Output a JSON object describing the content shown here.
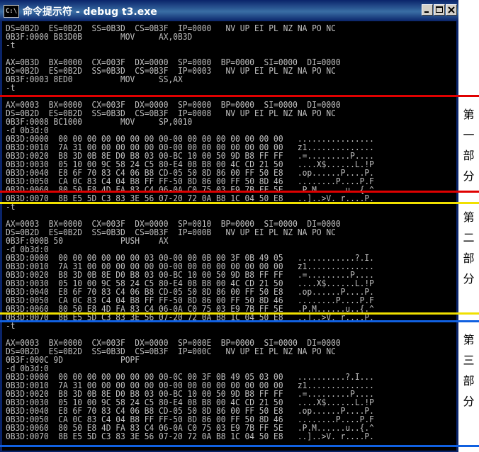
{
  "window": {
    "title": "命令提示符 - debug t3.exe",
    "icon_text": "C:\\",
    "buttons": [
      "minimize",
      "maximize",
      "close"
    ]
  },
  "colors": {
    "console_bg": "#000000",
    "console_text": "#c0c0c0",
    "titlebar": "#0a246a",
    "marker_red": "#e00000",
    "marker_yellow": "#f0e000",
    "marker_blue": "#1060e0"
  },
  "console": {
    "lines": [
      "DS=0B2D  ES=0B2D  SS=0B3D  CS=0B3F  IP=0000   NV UP EI PL NZ NA PO NC",
      "0B3F:0000 B83D0B        MOV     AX,0B3D",
      "-t",
      "",
      "AX=0B3D  BX=0000  CX=003F  DX=0000  SP=0000  BP=0000  SI=0000  DI=0000",
      "DS=0B2D  ES=0B2D  SS=0B3D  CS=0B3F  IP=0003   NV UP EI PL NZ NA PO NC",
      "0B3F:0003 8ED0          MOV     SS,AX",
      "-t",
      "",
      "AX=0003  BX=0000  CX=003F  DX=0000  SP=0000  BP=0000  SI=0000  DI=0000",
      "DS=0B2D  ES=0B2D  SS=0B3D  CS=0B3F  IP=0008   NV UP EI PL NZ NA PO NC",
      "0B3F:0008 BC1000        MOV     SP,0010",
      "-d 0b3d:0",
      "0B3D:0000  00 00 00 00 00 00 00 00-00 00 00 00 00 00 00 00   ................",
      "0B3D:0010  7A 31 00 00 00 00 00 00-00 00 00 00 00 00 00 00   z1..............",
      "0B3D:0020  B8 3D 0B 8E D0 B8 03 00-BC 10 00 50 9D B8 FF FF   .=.........P....",
      "0B3D:0030  05 10 00 9C 58 24 C5 80-E4 08 B8 00 4C CD 21 50   ....X$......L.!P",
      "0B3D:0040  E8 6F 70 83 C4 06 B8 CD-05 50 8D 86 00 FF 50 E8   .op......P....P.",
      "0B3D:0050  CA 0C 83 C4 04 B8 FF FF-50 8D 86 00 FF 50 8D 46   ........P....P.F",
      "0B3D:0060  80 50 E8 4D FA 83 C4 06-0A C0 75 03 E9 7B FF 5E   .P.M......u..{.^",
      "0B3D:0070  8B E5 5D C3 83 3E 56 07-20 72 0A B8 1C 04 50 E8   ..]..>V. r....P.",
      "-t",
      "",
      "AX=0003  BX=0000  CX=003F  DX=0000  SP=0010  BP=0000  SI=0000  DI=0000",
      "DS=0B2D  ES=0B2D  SS=0B3D  CS=0B3F  IP=000B   NV UP EI PL NZ NA PO NC",
      "0B3F:000B 50            PUSH    AX",
      "-d 0b3d:0",
      "0B3D:0000  00 00 00 00 00 00 03 00-00 00 0B 00 3F 0B 49 05   ............?.I.",
      "0B3D:0010  7A 31 00 00 00 00 00 00-00 00 00 00 00 00 00 00   z1..............",
      "0B3D:0020  B8 3D 0B 8E D0 B8 03 00-BC 10 00 50 9D B8 FF FF   .=.........P....",
      "0B3D:0030  05 10 00 9C 58 24 C5 80-E4 08 B8 00 4C CD 21 50   ....X$......L.!P",
      "0B3D:0040  E8 6F 70 83 C4 06 B8 CD-05 50 8D 86 00 FF 50 E8   .op......P....P.",
      "0B3D:0050  CA 0C 83 C4 04 B8 FF FF-50 8D 86 00 FF 50 8D 46   ........P....P.F",
      "0B3D:0060  80 50 E8 4D FA 83 C4 06-0A C0 75 03 E9 7B FF 5E   .P.M......u..{.^",
      "0B3D:0070  8B E5 5D C3 83 3E 56 07-20 72 0A B8 1C 04 50 E8   ..]..>V. r....P.",
      "-t",
      "",
      "AX=0003  BX=0000  CX=003F  DX=0000  SP=000E  BP=0000  SI=0000  DI=0000",
      "DS=0B2D  ES=0B2D  SS=0B3D  CS=0B3F  IP=000C   NV UP EI PL NZ NA PO NC",
      "0B3F:000C 9D            POPF",
      "-d 0b3d:0",
      "0B3D:0000  00 00 00 00 00 00 00 00-0C 00 3F 0B 49 05 03 00   ..........?.I...",
      "0B3D:0010  7A 31 00 00 00 00 00 00-00 00 00 00 00 00 00 00   z1..............",
      "0B3D:0020  B8 3D 0B 8E D0 B8 03 00-BC 10 00 50 9D B8 FF FF   .=.........P....",
      "0B3D:0030  05 10 00 9C 58 24 C5 80-E4 08 B8 00 4C CD 21 50   ....X$......L.!P",
      "0B3D:0040  E8 6F 70 83 C4 06 B8 CD-05 50 8D 86 00 FF 50 E8   .op......P....P.",
      "0B3D:0050  CA 0C 83 C4 04 B8 FF FF-50 8D 86 00 FF 50 8D 46   ........P....P.F",
      "0B3D:0060  80 50 E8 4D FA 83 C4 06-0A C0 75 03 E9 7B FF 5E   .P.M......u..{.^",
      "0B3D:0070  8B E5 5D C3 83 3E 56 07-20 72 0A B8 1C 04 50 E8   ..]..>V. r....P."
    ]
  },
  "annotations": {
    "section_labels": [
      [
        "第",
        "一",
        "部",
        "分"
      ],
      [
        "第",
        "二",
        "部",
        "分"
      ],
      [
        "第",
        "三",
        "部",
        "分"
      ]
    ],
    "markers": [
      "red",
      "red",
      "yellow",
      "yellow",
      "blue",
      "blue"
    ]
  }
}
